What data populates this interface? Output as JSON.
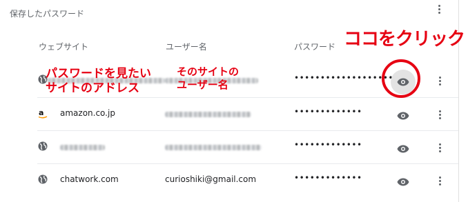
{
  "section": {
    "title": "保存したパスワード"
  },
  "columns": {
    "website": "ウェブサイト",
    "username": "ユーザー名",
    "password": "パスワード"
  },
  "rows": [
    {
      "icon": "globe-icon",
      "site": "",
      "username": "",
      "password": "•••••••••••••••••••",
      "site_masked": true,
      "user_masked": true
    },
    {
      "icon": "amazon-logo-icon",
      "site": "amazon.co.jp",
      "username": "",
      "password": "•••••••••••••",
      "site_masked": false,
      "user_masked": true
    },
    {
      "icon": "globe-icon",
      "site": "",
      "username": "",
      "password": "•••••••••••••",
      "site_masked": true,
      "user_masked": true
    },
    {
      "icon": "globe-icon",
      "site": "chatwork.com",
      "username": "curioshiki@gmail.com",
      "password": "•••••••••••••",
      "site_masked": false,
      "user_masked": false
    }
  ],
  "annotations": {
    "click_here": "ココをクリック",
    "site_address": "パスワードを見たい\nサイトのアドレス",
    "site_username": "そのサイトの\nユーザー名"
  },
  "colors": {
    "annotation": "#e60012",
    "text": "#202124",
    "secondary": "#5f6368",
    "eye_active_bg": "#e3e3e3"
  }
}
